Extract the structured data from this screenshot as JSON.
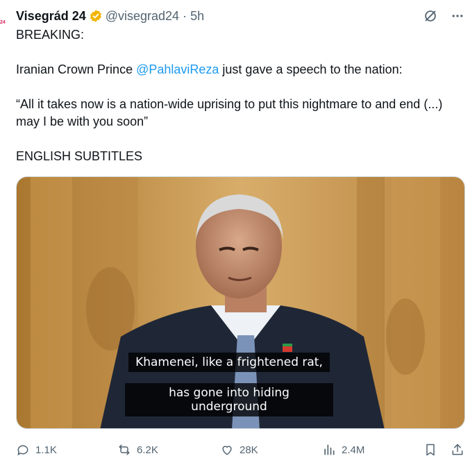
{
  "colors": {
    "accent": "#1d9bf0",
    "verified": "#f2b400",
    "muted": "#536471"
  },
  "avatar": {
    "text": "24"
  },
  "header": {
    "display_name": "Visegrád 24",
    "handle": "@visegrad24",
    "separator": "·",
    "time": "5h",
    "verified_icon": "verified-badge-icon"
  },
  "tweet": {
    "line1": "BREAKING:",
    "line2_pre": "Iranian Crown Prince ",
    "line2_mention": "@PahlaviReza",
    "line2_post": " just gave a speech to the nation:",
    "quote": "“All it takes now is a nation-wide uprising to put this nightmare to and end (...) may I be with you soon”",
    "line4": "ENGLISH SUBTITLES"
  },
  "media": {
    "subtitle_line1": "Khamenei, like a frightened rat,",
    "subtitle_line2": "has gone into hiding underground"
  },
  "actions": {
    "replies": "1.1K",
    "reposts": "6.2K",
    "likes": "28K",
    "views": "2.4M"
  }
}
